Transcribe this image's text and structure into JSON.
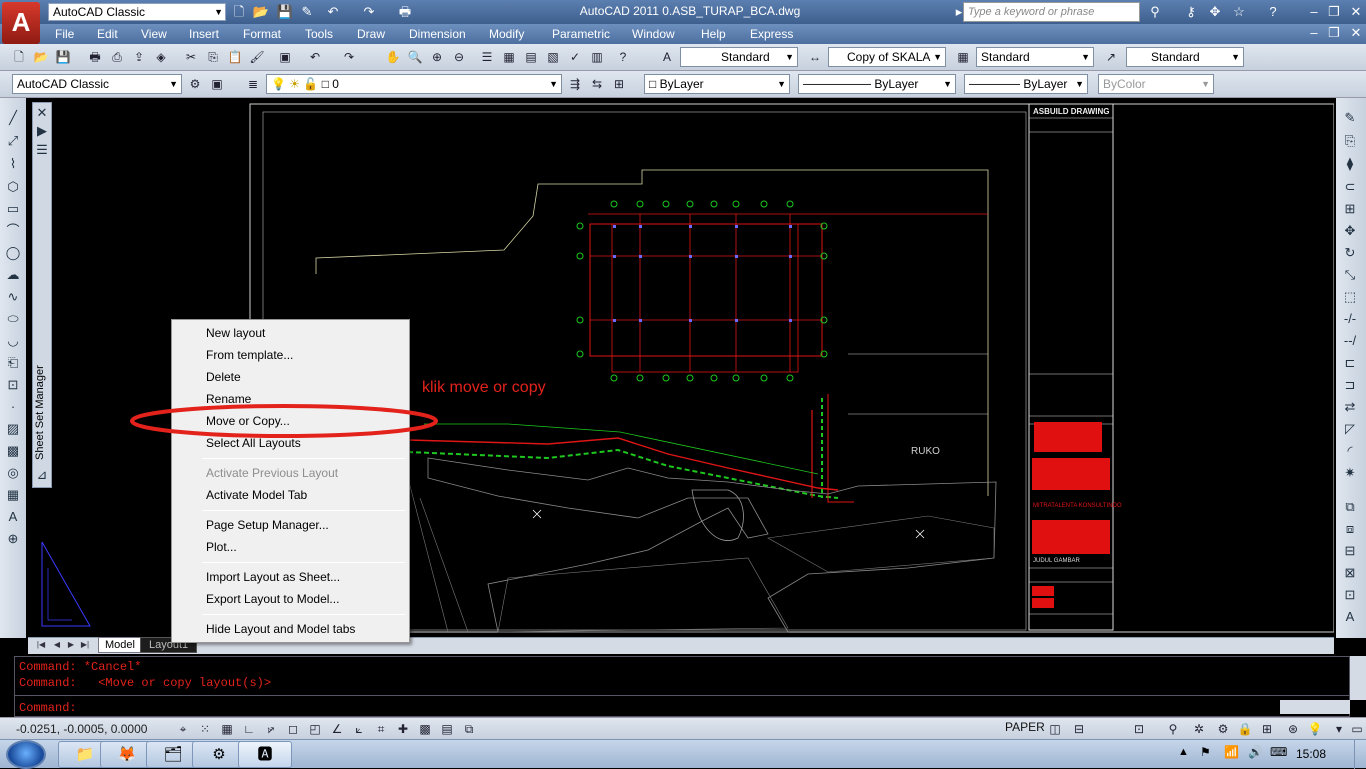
{
  "titlebar": {
    "app_logo": "A",
    "workspace": "AutoCAD Classic",
    "title": "AutoCAD 2011    0.ASB_TURAP_BCA.dwg",
    "search_placeholder": "Type a keyword or phrase"
  },
  "menu": [
    "File",
    "Edit",
    "View",
    "Insert",
    "Format",
    "Tools",
    "Draw",
    "Dimension",
    "Modify",
    "Parametric",
    "Window",
    "Help",
    "Express"
  ],
  "toolbar1": {
    "text_style": "Standard",
    "dim_style": "Copy of SKALA",
    "table_style": "Standard",
    "mleader_style": "Standard"
  },
  "toolbar2": {
    "workspace": "AutoCAD Classic",
    "layer": "0",
    "color": "ByLayer",
    "linetype": "ByLayer",
    "lineweight": "ByLayer",
    "plot_style": "ByColor"
  },
  "palette": {
    "sheet_set_manager": "Sheet Set Manager"
  },
  "drawing": {
    "ruko_label": "RUKO",
    "titleblock_heading": "ASBUILD DRAWING",
    "company": "MITRATALENTA KONSULTINDO",
    "sheet_label": "JUDUL GAMBAR"
  },
  "tabs": {
    "model": "Model",
    "layout1": "Layout1"
  },
  "context_menu": {
    "items": [
      {
        "label": "New layout",
        "disabled": false
      },
      {
        "label": "From template...",
        "disabled": false
      },
      {
        "label": "Delete",
        "disabled": false
      },
      {
        "label": "Rename",
        "disabled": false
      },
      {
        "label": "Move or Copy...",
        "disabled": false
      },
      {
        "label": "Select All Layouts",
        "disabled": false
      },
      {
        "label": "Activate Previous Layout",
        "disabled": true
      },
      {
        "label": "Activate Model Tab",
        "disabled": false
      },
      {
        "label": "Page Setup Manager...",
        "disabled": false
      },
      {
        "label": "Plot...",
        "disabled": false
      },
      {
        "label": "Import Layout as Sheet...",
        "disabled": false
      },
      {
        "label": "Export Layout to Model...",
        "disabled": false
      },
      {
        "label": "Hide Layout and Model tabs",
        "disabled": false
      }
    ]
  },
  "annotation": {
    "text": "klik move or copy",
    "color": "#e2221b"
  },
  "command_line": {
    "line1": "Command: *Cancel*",
    "line2": "Command:   <Move or copy layout(s)>",
    "prompt": "Command:"
  },
  "statusbar": {
    "coords": "-0.0251, -0.0005, 0.0000",
    "space": "PAPER"
  },
  "taskbar": {
    "clock": "15:08"
  },
  "colors": {
    "command_text": "#e2221b",
    "titlebar": "#4d6f9f",
    "drawing_bg": "#000000"
  }
}
